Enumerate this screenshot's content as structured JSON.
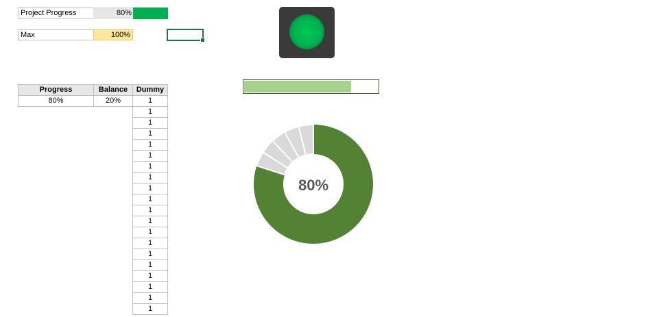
{
  "progress": {
    "label": "Project Progress",
    "value_text": "80%",
    "value": 0.8
  },
  "max": {
    "label": "Max",
    "value_text": "100%"
  },
  "table": {
    "headers": {
      "progress": "Progress",
      "balance": "Balance",
      "dummy": "Dummy"
    },
    "row": {
      "progress": "80%",
      "balance": "20%"
    },
    "dummy_values": [
      "1",
      "1",
      "1",
      "1",
      "1",
      "1",
      "1",
      "1",
      "1",
      "1",
      "1",
      "1",
      "1",
      "1",
      "1",
      "1",
      "1",
      "1",
      "1",
      "1"
    ]
  },
  "traffic_light": {
    "status": "green",
    "color": "#00b050"
  },
  "progress_bar": {
    "fill_fraction": 0.8,
    "fill_color": "#a9d18e",
    "border_color": "#3a5a22"
  },
  "chart_data": {
    "type": "pie",
    "subtype": "doughnut",
    "center_label": "80%",
    "progress_value": 0.8,
    "progress_color": "#548235",
    "remainder_segments": 5,
    "remainder_color": "#d9d9d9",
    "separator_color": "#ffffff"
  },
  "colors": {
    "accent_green": "#00b050",
    "max_highlight": "#ffe699",
    "header_gray": "#e7e7e7"
  }
}
